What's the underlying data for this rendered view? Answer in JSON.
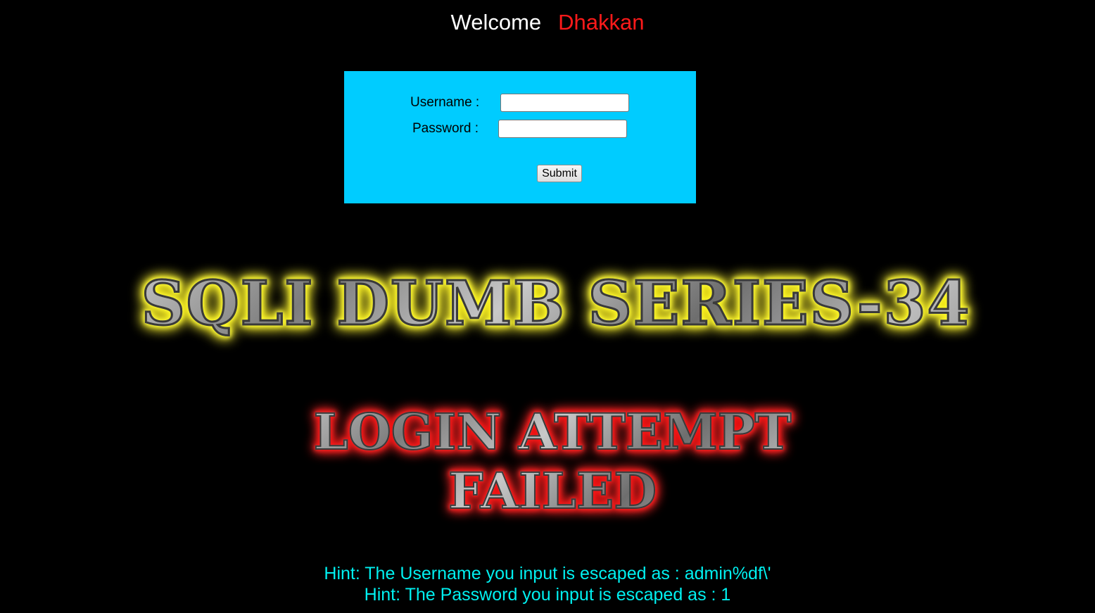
{
  "header": {
    "welcome_text": "Welcome",
    "user_name": "Dhakkan"
  },
  "login_form": {
    "username_label": "Username :",
    "password_label": "Password :",
    "username_value": "",
    "password_value": "",
    "submit_label": "Submit",
    "background_color": "#00ccff"
  },
  "banners": {
    "series_title": "SQLI DUMB SERIES-34",
    "failed_line1": "LOGIN ATTEMPT",
    "failed_line2": "FAILED"
  },
  "hints": {
    "username_hint": "Hint: The Username you input is escaped as : admin%df\\'",
    "password_hint": "Hint: The Password you input is escaped as : 1"
  },
  "colors": {
    "page_background": "#000000",
    "welcome_text": "#ffffff",
    "user_name": "#ff1a1a",
    "hint_text": "#00f0f0",
    "series_glow": "#ffff33",
    "failed_glow": "#ff1a1a"
  }
}
